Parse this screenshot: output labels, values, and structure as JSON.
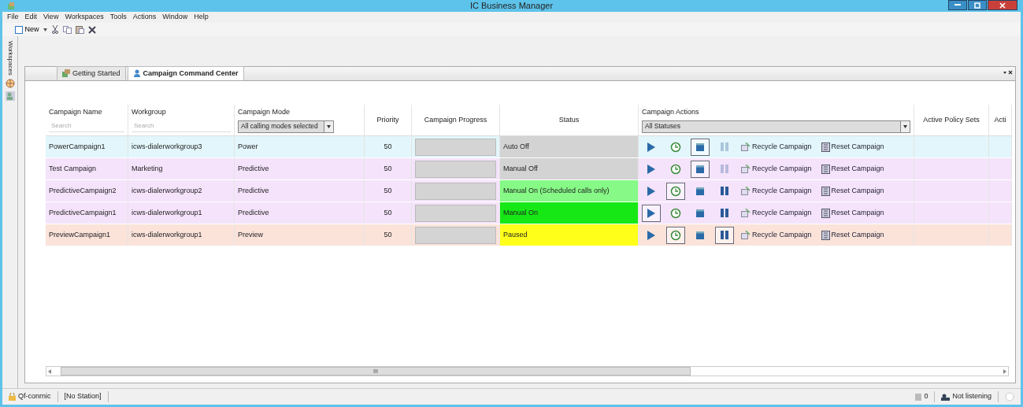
{
  "window": {
    "title": "IC Business Manager"
  },
  "menu": [
    "File",
    "Edit",
    "View",
    "Workspaces",
    "Tools",
    "Actions",
    "Window",
    "Help"
  ],
  "toolbar": {
    "new_label": "New"
  },
  "side_strip": {
    "label": "Workspaces"
  },
  "tabs": [
    {
      "label": "Getting Started",
      "selected": false
    },
    {
      "label": "Campaign Command Center",
      "selected": true
    }
  ],
  "table": {
    "columns": [
      {
        "label": "Campaign Name",
        "filter": {
          "kind": "search",
          "placeholder": "Search"
        }
      },
      {
        "label": "Workgroup",
        "filter": {
          "kind": "search",
          "placeholder": "Search"
        }
      },
      {
        "label": "Campaign Mode",
        "filter": {
          "kind": "combo",
          "value": "All calling modes selected"
        }
      },
      {
        "label": "Priority"
      },
      {
        "label": "Campaign Progress"
      },
      {
        "label": "Status"
      },
      {
        "label": "Campaign Actions",
        "filter": {
          "kind": "combo",
          "value": "All Statuses"
        }
      },
      {
        "label": "Active Policy Sets"
      },
      {
        "label": "Acti"
      }
    ],
    "rows": [
      {
        "name": "PowerCampaign1",
        "workgroup": "icws-dialerworkgroup3",
        "mode": "Power",
        "priority": "50",
        "level": 0,
        "status": {
          "text": "Auto Off",
          "color": "#d3d3d3"
        },
        "color": "#e2f6fb",
        "actions": [
          {
            "kind": "start",
            "pressed": false,
            "disabled": false
          },
          {
            "kind": "recycle",
            "pressed": false,
            "disabled": false
          },
          {
            "kind": "stop",
            "pressed": true,
            "disabled": false
          },
          {
            "kind": "pause",
            "pressed": false,
            "disabled": true
          }
        ],
        "links": [
          "Recycle Campaign",
          "Reset Campaign"
        ]
      },
      {
        "name": "Test Campaign",
        "workgroup": "Marketing",
        "mode": "Predictive",
        "priority": "50",
        "level": 0,
        "status": {
          "text": "Manual Off",
          "color": "#d3d3d3"
        },
        "color": "#f5e3fb",
        "actions": [
          {
            "kind": "start",
            "pressed": false,
            "disabled": false
          },
          {
            "kind": "recycle",
            "pressed": false,
            "disabled": false
          },
          {
            "kind": "stop",
            "pressed": true,
            "disabled": false
          },
          {
            "kind": "pause",
            "pressed": false,
            "disabled": true
          }
        ],
        "links": [
          "Recycle Campaign",
          "Reset Campaign"
        ]
      },
      {
        "name": "PredictiveCampaign2",
        "workgroup": "icws-dialerworkgroup2",
        "mode": "Predictive",
        "priority": "50",
        "level": 0,
        "status": {
          "text": "Manual On (Scheduled calls only)",
          "color": "#86f986"
        },
        "color": "#f5e3fb",
        "actions": [
          {
            "kind": "start",
            "pressed": false,
            "disabled": false
          },
          {
            "kind": "recycle",
            "pressed": true,
            "disabled": false
          },
          {
            "kind": "stop",
            "pressed": false,
            "disabled": false
          },
          {
            "kind": "pause",
            "pressed": false,
            "disabled": false
          }
        ],
        "links": [
          "Recycle Campaign",
          "Reset Campaign"
        ]
      },
      {
        "name": "PredictiveCampaign1",
        "workgroup": "icws-dialerworkgroup1",
        "mode": "Predictive",
        "priority": "50",
        "level": 0,
        "status": {
          "text": "Manual On",
          "color": "#16e816"
        },
        "color": "#f5e3fb",
        "actions": [
          {
            "kind": "start",
            "pressed": true,
            "disabled": false
          },
          {
            "kind": "recycle",
            "pressed": false,
            "disabled": false
          },
          {
            "kind": "stop",
            "pressed": false,
            "disabled": false
          },
          {
            "kind": "pause",
            "pressed": false,
            "disabled": false
          }
        ],
        "links": [
          "Recycle Campaign",
          "Reset Campaign"
        ]
      },
      {
        "name": "PreviewCampaign1",
        "workgroup": "icws-dialerworkgroup1",
        "mode": "Preview",
        "priority": "50",
        "level": 0,
        "status": {
          "text": "Paused",
          "color": "#ffff1a"
        },
        "color": "#fbe3da",
        "actions": [
          {
            "kind": "start",
            "pressed": false,
            "disabled": false
          },
          {
            "kind": "recycle",
            "pressed": true,
            "disabled": false
          },
          {
            "kind": "stop",
            "pressed": false,
            "disabled": false
          },
          {
            "kind": "pause",
            "pressed": true,
            "disabled": false
          }
        ],
        "links": [
          "Recycle Campaign",
          "Reset Campaign"
        ]
      }
    ]
  },
  "status_bar": {
    "user": "Qf-conrnic",
    "station": "[No Station]",
    "count": "0",
    "listening": "Not listening"
  }
}
